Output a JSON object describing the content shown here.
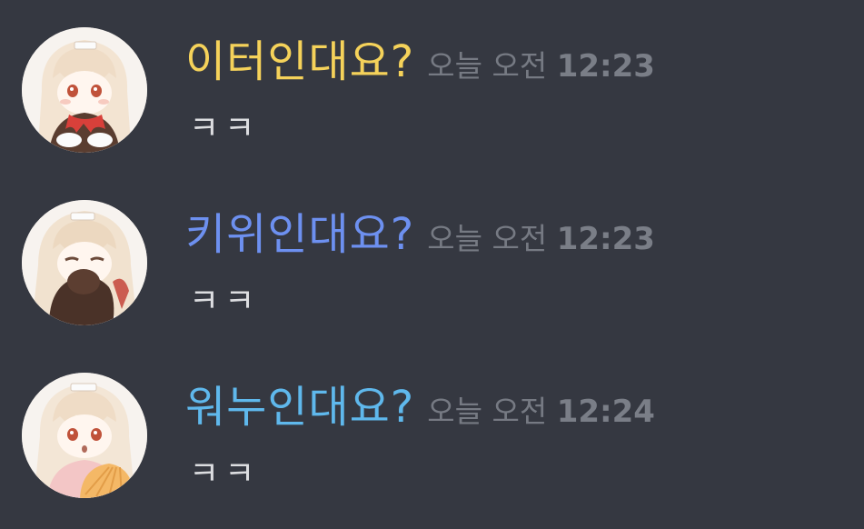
{
  "messages": [
    {
      "username": "이터인대요?",
      "username_color": "#f5d25a",
      "timestamp_date": "오늘 오전",
      "timestamp_time": "12:23",
      "content": "ㅋㅋ",
      "avatar_icon": "anime-girl-red-scarf-avatar"
    },
    {
      "username": "키위인대요?",
      "username_color": "#6d90f0",
      "timestamp_date": "오늘 오전",
      "timestamp_time": "12:23",
      "content": "ㅋㅋ",
      "avatar_icon": "anime-girl-covering-mouth-avatar"
    },
    {
      "username": "워누인대요?",
      "username_color": "#5fb8ec",
      "timestamp_date": "오늘 오전",
      "timestamp_time": "12:24",
      "content": "ㅋㅋ",
      "avatar_icon": "anime-girl-holding-fan-avatar"
    }
  ]
}
